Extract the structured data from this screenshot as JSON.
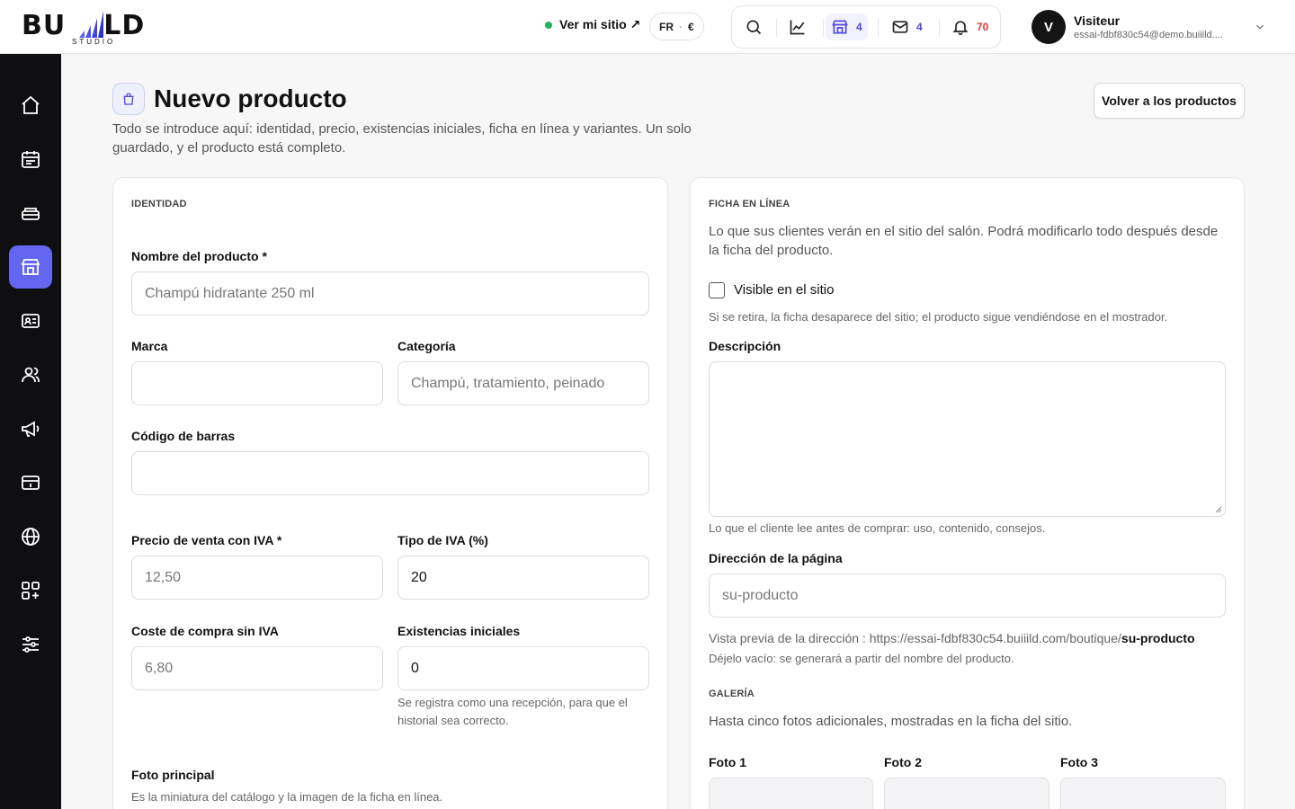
{
  "header": {
    "logo_text": "BUILD",
    "logo_sub": "STUDIO",
    "site_link": "Ver mi sitio ↗",
    "lang": "FR",
    "currency": "€",
    "tools": [
      {
        "icon": "search-icon",
        "count": ""
      },
      {
        "icon": "chart-icon",
        "count": ""
      },
      {
        "icon": "store-icon",
        "count": "4"
      },
      {
        "icon": "mail-icon",
        "count": "4"
      },
      {
        "icon": "bell-icon",
        "count": "70"
      }
    ],
    "user": {
      "initial": "V",
      "name": "Visiteur",
      "email": "essai-fdbf830c54@demo.buiiild...."
    }
  },
  "sidebar": {
    "items": [
      {
        "icon": "home-icon"
      },
      {
        "icon": "calendar-icon"
      },
      {
        "icon": "stack-icon"
      },
      {
        "icon": "store-icon",
        "active": true
      },
      {
        "icon": "contact-card-icon"
      },
      {
        "icon": "users-icon"
      },
      {
        "icon": "megaphone-icon"
      },
      {
        "icon": "payment-icon"
      },
      {
        "icon": "globe-icon"
      },
      {
        "icon": "apps-icon"
      },
      {
        "icon": "settings-sliders-icon"
      }
    ]
  },
  "page": {
    "title": "Nuevo producto",
    "description": "Todo se introduce aquí: identidad, precio, existencias iniciales, ficha en línea y variantes. Un solo guardado, y el producto está completo.",
    "back_button": "Volver a los productos"
  },
  "identity": {
    "section": "IDENTIDAD",
    "name_label": "Nombre del producto *",
    "name_placeholder": "Champú hidratante 250 ml",
    "brand_label": "Marca",
    "brand_value": "",
    "category_label": "Categoría",
    "category_placeholder": "Champú, tratamiento, peinado",
    "barcode_label": "Código de barras",
    "barcode_value": "",
    "price_label": "Precio de venta con IVA *",
    "price_placeholder": "12,50",
    "vat_label": "Tipo de IVA (%)",
    "vat_value": "20",
    "cost_label": "Coste de compra sin IVA",
    "cost_placeholder": "6,80",
    "stock_label": "Existencias iniciales",
    "stock_value": "0",
    "stock_help": "Se registra como una recepción, para que el historial sea correcto.",
    "photo_label": "Foto principal",
    "photo_help": "Es la miniatura del catálogo y la imagen de la ficha en línea."
  },
  "online": {
    "section": "FICHA EN LÍNEA",
    "intro": "Lo que sus clientes verán en el sitio del salón. Podrá modificarlo todo después desde la ficha del producto.",
    "visible_label": "Visible en el sitio",
    "visible_checked": false,
    "visible_help": "Si se retira, la ficha desaparece del sitio; el producto sigue vendiéndose en el mostrador.",
    "description_label": "Descripción",
    "description_value": "",
    "description_help": "Lo que el cliente lee antes de comprar: uso, contenido, consejos.",
    "address_label": "Dirección de la página",
    "address_placeholder": "su-producto",
    "preview_prefix": "Vista previa de la dirección : https://essai-fdbf830c54.buiiild.com/boutique/",
    "preview_slug": "su-producto",
    "address_help": "Déjelo vacío: se generará a partir del nombre del producto.",
    "gallery_section": "GALERÍA",
    "gallery_help": "Hasta cinco fotos adicionales, mostradas en la ficha del sitio.",
    "photos": [
      "Foto 1",
      "Foto 2",
      "Foto 3"
    ]
  }
}
